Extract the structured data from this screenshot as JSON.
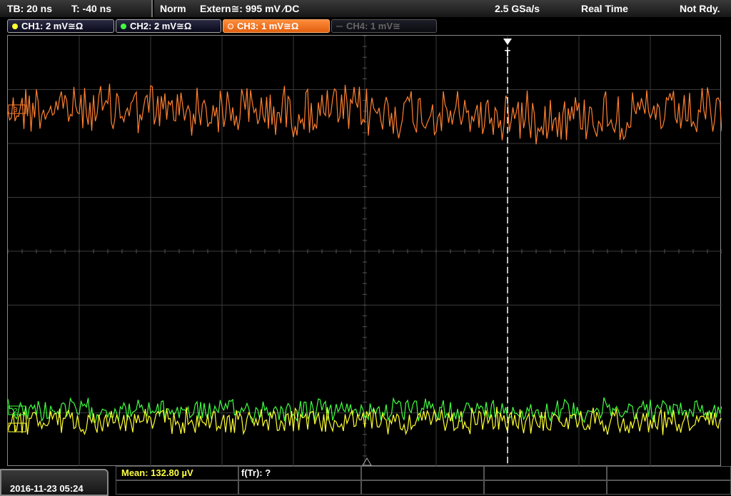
{
  "topbar": {
    "timebase": "TB: 20 ns",
    "trigger_time": "T: -40 ns",
    "mode": "Norm",
    "trigger_source": "Extern≅: 995 mV ⁄DC",
    "sample_rate": "2.5 GSa/s",
    "acq_mode": "Real Time",
    "status": "Not Rdy."
  },
  "channels": [
    {
      "label": "CH1: 2 mV≅Ω",
      "color": "#ffff30",
      "state": "on"
    },
    {
      "label": "CH2: 2 mV≅Ω",
      "color": "#40ff40",
      "state": "on"
    },
    {
      "label": "CH3: 1 mV≅Ω",
      "color": "#ff8030",
      "state": "active"
    },
    {
      "label": "CH4: 1 mV≅",
      "color": "#666666",
      "state": "off"
    }
  ],
  "markers": {
    "ch3_label": "3",
    "ch1_label": "1",
    "ch2_label": "2",
    "trigger_label": "T"
  },
  "bottom": {
    "datetime": "2016-11-23 05:24",
    "measurement_mean": "Mean: 132.80 µV",
    "measurement_ftr": "f(Tr): ?"
  },
  "colors": {
    "ch1": "#ffff30",
    "ch2": "#40ff40",
    "ch3": "#ff8030",
    "grid": "#444444"
  }
}
